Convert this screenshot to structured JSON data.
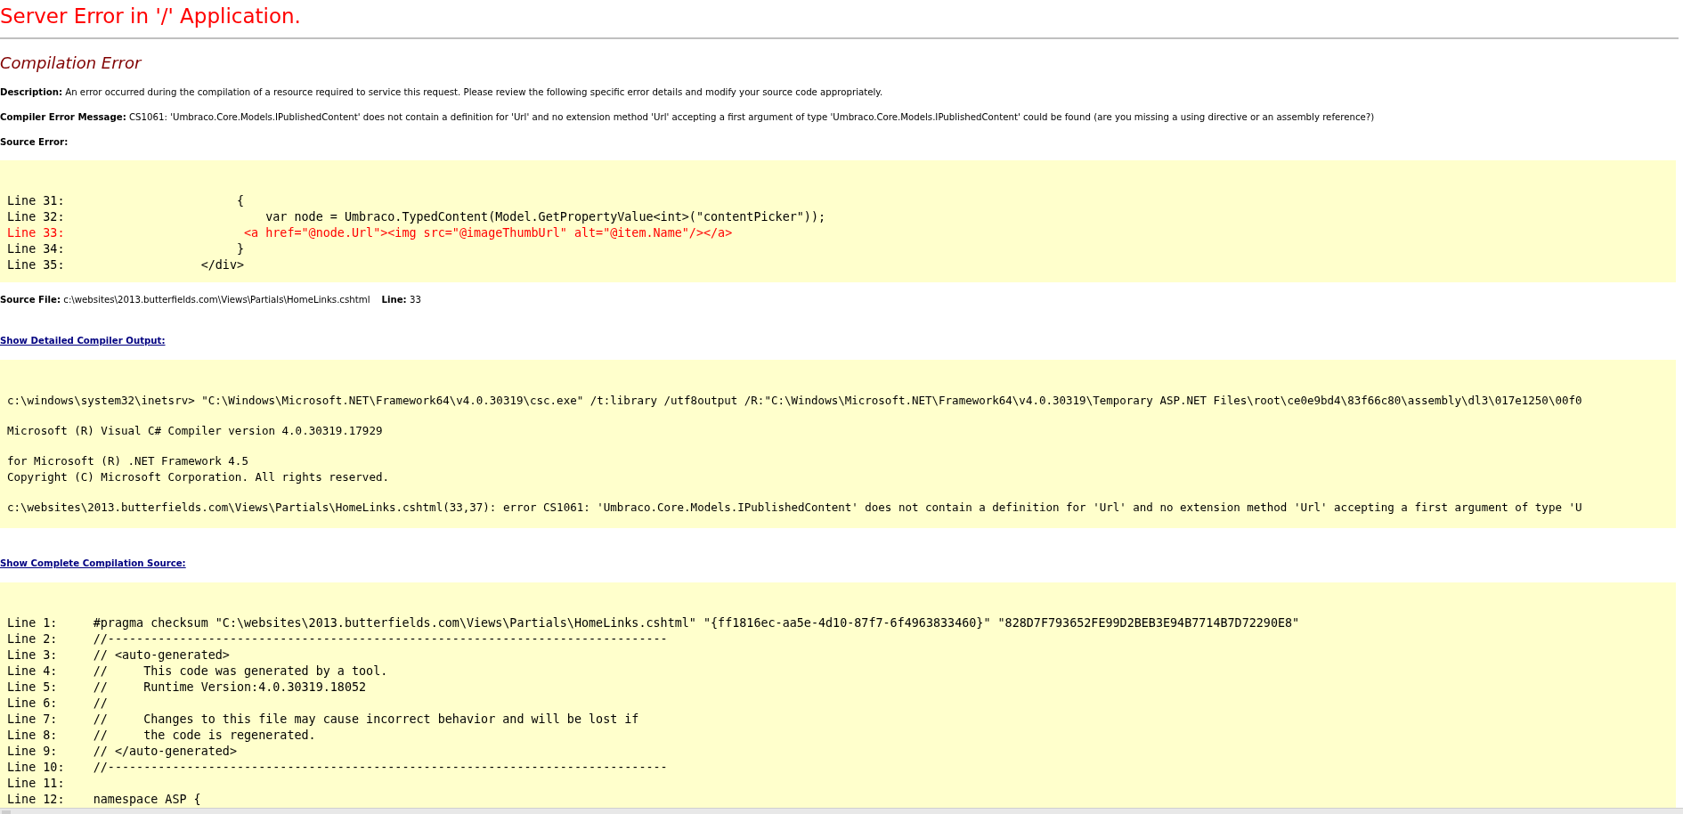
{
  "page_title": "Server Error in '/' Application.",
  "error_heading": "Compilation Error",
  "description": {
    "label": "Description:",
    "text": "An error occurred during the compilation of a resource required to service this request. Please review the following specific error details and modify your source code appropriately."
  },
  "compiler_error_message": {
    "label": "Compiler Error Message:",
    "text": "CS1061: 'Umbraco.Core.Models.IPublishedContent' does not contain a definition for 'Url' and no extension method 'Url' accepting a first argument of type 'Umbraco.Core.Models.IPublishedContent' could be found (are you missing a using directive or an assembly reference?)"
  },
  "source_error": {
    "label": "Source Error:",
    "lines": [
      {
        "line": "Line 31:",
        "code": "                    {",
        "highlighted": false
      },
      {
        "line": "Line 32:",
        "code": "                        var node = Umbraco.TypedContent(Model.GetPropertyValue<int>(\"contentPicker\"));",
        "highlighted": false
      },
      {
        "line": "Line 33:",
        "code": "                     <a href=\"@node.Url\"><img src=\"@imageThumbUrl\" alt=\"@item.Name\"/></a>",
        "highlighted": true
      },
      {
        "line": "Line 34:",
        "code": "                    }",
        "highlighted": false
      },
      {
        "line": "Line 35:",
        "code": "               </div>",
        "highlighted": false
      }
    ]
  },
  "source_file": {
    "label": "Source File:",
    "path": "c:\\websites\\2013.butterfields.com\\Views\\Partials\\HomeLinks.cshtml",
    "line_label": "Line:",
    "line": "33"
  },
  "detailed_output_link": "Show Detailed Compiler Output:",
  "compiler_output": [
    [
      "c:\\windows\\system32\\inetsrv> \"C:\\Windows\\Microsoft.NET\\Framework64\\v4.0.30319\\csc.exe\" /t:library /utf8output /R:\"C:\\Windows\\Microsoft.NET\\Framework64\\v4.0.30319\\Temporary ASP.NET Files\\root\\ce0e9bd4\\83f66c80\\assembly\\dl3\\017e1250\\00f0"
    ],
    [
      "Microsoft (R) Visual C# Compiler version 4.0.30319.17929"
    ],
    [
      "for Microsoft (R) .NET Framework 4.5",
      "Copyright (C) Microsoft Corporation. All rights reserved."
    ],
    [
      "c:\\websites\\2013.butterfields.com\\Views\\Partials\\HomeLinks.cshtml(33,37): error CS1061: 'Umbraco.Core.Models.IPublishedContent' does not contain a definition for 'Url' and no extension method 'Url' accepting a first argument of type 'U"
    ]
  ],
  "complete_source_link": "Show Complete Compilation Source:",
  "compilation_source": [
    {
      "line": "Line 1:",
      "code": "#pragma checksum \"C:\\websites\\2013.butterfields.com\\Views\\Partials\\HomeLinks.cshtml\" \"{ff1816ec-aa5e-4d10-87f7-6f4963833460}\" \"828D7F793652FE99D2BEB3E94B7714B7D72290E8\""
    },
    {
      "line": "Line 2:",
      "code": "//------------------------------------------------------------------------------"
    },
    {
      "line": "Line 3:",
      "code": "// <auto-generated>"
    },
    {
      "line": "Line 4:",
      "code": "//     This code was generated by a tool."
    },
    {
      "line": "Line 5:",
      "code": "//     Runtime Version:4.0.30319.18052"
    },
    {
      "line": "Line 6:",
      "code": "//"
    },
    {
      "line": "Line 7:",
      "code": "//     Changes to this file may cause incorrect behavior and will be lost if"
    },
    {
      "line": "Line 8:",
      "code": "//     the code is regenerated."
    },
    {
      "line": "Line 9:",
      "code": "// </auto-generated>"
    },
    {
      "line": "Line 10:",
      "code": "//------------------------------------------------------------------------------"
    },
    {
      "line": "Line 11:"
    },
    {
      "line": "Line 12:",
      "code": "namespace ASP {"
    }
  ]
}
